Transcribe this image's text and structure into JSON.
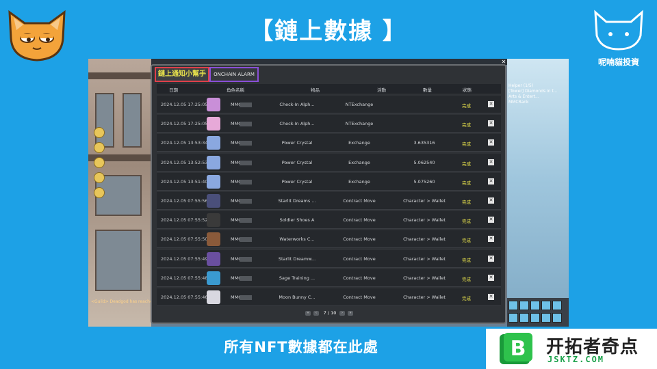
{
  "header": {
    "title": "【鏈上數據 】"
  },
  "footer": {
    "caption": "所有NFT數據都在此處"
  },
  "brand": {
    "right_label": "呢喃貓投資"
  },
  "watermark": {
    "cn": "开拓者奇点",
    "en": "JSKTZ.COM",
    "mark_letter": "B"
  },
  "dialog": {
    "tab_active": "鏈上通知小幫手",
    "tab_inactive": "ONCHAIN ALARM",
    "columns": [
      "日期",
      "角色名稱",
      "物品",
      "活動",
      "數量",
      "狀態"
    ],
    "rows": [
      {
        "date": "2024.12.05 17:25:05",
        "char": "MMC",
        "item": "Check-In Alph...",
        "dest": "NTExchange",
        "amount": "",
        "status": "完成",
        "icon_color": "#c98fd8"
      },
      {
        "date": "2024.12.05 17:25:05",
        "char": "MMC",
        "item": "Check-In Alph...",
        "dest": "NTExchange",
        "amount": "",
        "status": "完成",
        "icon_color": "#e7a9d8"
      },
      {
        "date": "2024.12.05 13:53:34",
        "char": "MMC",
        "item": "Power Crystal",
        "dest": "Exchange",
        "amount": "3.635316",
        "status": "完成",
        "icon_color": "#8aa8e0"
      },
      {
        "date": "2024.12.05 13:52:53",
        "char": "MMC",
        "item": "Power Crystal",
        "dest": "Exchange",
        "amount": "5.062540",
        "status": "完成",
        "icon_color": "#8aa8e0"
      },
      {
        "date": "2024.12.05 13:51:40",
        "char": "MMC",
        "item": "Power Crystal",
        "dest": "Exchange",
        "amount": "5.075260",
        "status": "完成",
        "icon_color": "#8aa8e0"
      },
      {
        "date": "2024.12.05 07:55:56",
        "char": "MMC",
        "item": "Starlit Dreams ...",
        "dest": "Contract Move",
        "amount": "Character > Wallet",
        "status": "完成",
        "icon_color": "#4a4f7a"
      },
      {
        "date": "2024.12.05 07:55:52",
        "char": "MMC",
        "item": "Soldier Shoes A",
        "dest": "Contract Move",
        "amount": "Character > Wallet",
        "status": "完成",
        "icon_color": "#3a3a3a"
      },
      {
        "date": "2024.12.05 07:55:50",
        "char": "MMC",
        "item": "Waterworks C...",
        "dest": "Contract Move",
        "amount": "Character > Wallet",
        "status": "完成",
        "icon_color": "#8a5a3a"
      },
      {
        "date": "2024.12.05 07:55:49",
        "char": "MMC",
        "item": "Starlit Dreamw...",
        "dest": "Contract Move",
        "amount": "Character > Wallet",
        "status": "完成",
        "icon_color": "#6a4fa0"
      },
      {
        "date": "2024.12.05 07:55:48",
        "char": "MMC",
        "item": "Sage Training ...",
        "dest": "Contract Move",
        "amount": "Character > Wallet",
        "status": "完成",
        "icon_color": "#3a9ad0"
      },
      {
        "date": "2024.12.05 07:55:46",
        "char": "MMC",
        "item": "Moon Bunny C...",
        "dest": "Contract Move",
        "amount": "Character > Wallet",
        "status": "完成",
        "icon_color": "#d8d8e0"
      }
    ],
    "pager": {
      "label": "7 / 10"
    }
  },
  "game": {
    "chat": "<Guild> Deadgod has reached",
    "quest_helper_lines": [
      "Helper (1/5)",
      "[Tower] Diamonds in t...",
      "Arts & Entert...",
      "MMCRank"
    ]
  }
}
